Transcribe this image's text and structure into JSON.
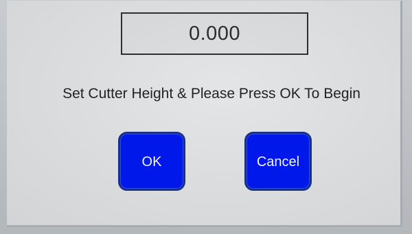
{
  "display": {
    "value": "0.000"
  },
  "prompt": {
    "text": "Set Cutter Height & Please Press OK To Begin"
  },
  "buttons": {
    "ok_label": "OK",
    "cancel_label": "Cancel"
  },
  "colors": {
    "button_fill": "#0018ea",
    "button_border": "#19308a",
    "screen_background": "#dcdddf",
    "text": "#1f2124"
  }
}
